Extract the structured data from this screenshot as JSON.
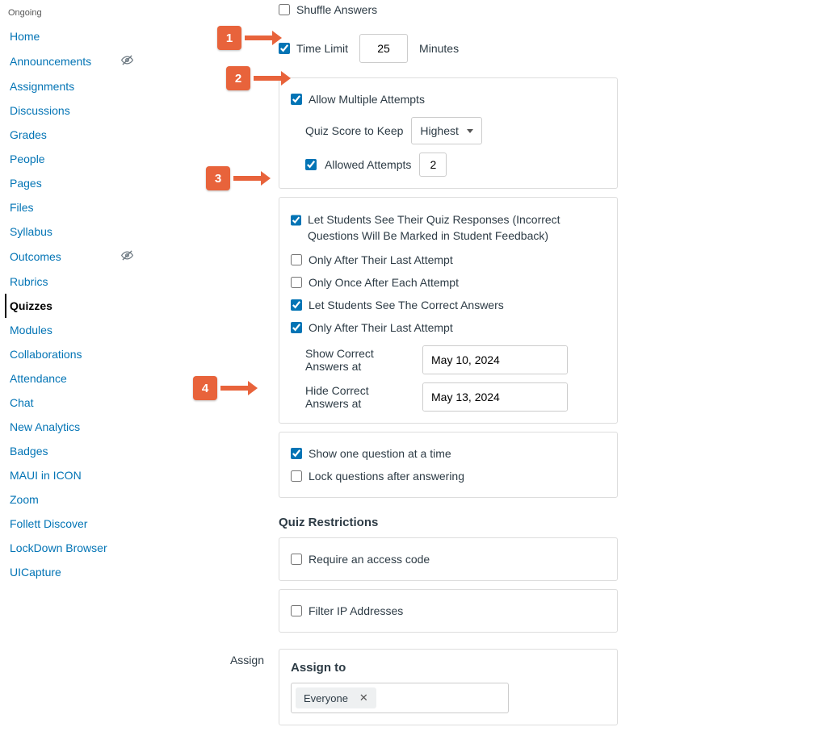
{
  "sidebar": {
    "heading": "Ongoing",
    "items": [
      {
        "label": "Home",
        "hidden": false,
        "active": false
      },
      {
        "label": "Announcements",
        "hidden": true,
        "active": false
      },
      {
        "label": "Assignments",
        "hidden": false,
        "active": false
      },
      {
        "label": "Discussions",
        "hidden": false,
        "active": false
      },
      {
        "label": "Grades",
        "hidden": false,
        "active": false
      },
      {
        "label": "People",
        "hidden": false,
        "active": false
      },
      {
        "label": "Pages",
        "hidden": false,
        "active": false
      },
      {
        "label": "Files",
        "hidden": false,
        "active": false
      },
      {
        "label": "Syllabus",
        "hidden": false,
        "active": false
      },
      {
        "label": "Outcomes",
        "hidden": true,
        "active": false
      },
      {
        "label": "Rubrics",
        "hidden": false,
        "active": false
      },
      {
        "label": "Quizzes",
        "hidden": false,
        "active": true
      },
      {
        "label": "Modules",
        "hidden": false,
        "active": false
      },
      {
        "label": "Collaborations",
        "hidden": false,
        "active": false
      },
      {
        "label": "Attendance",
        "hidden": false,
        "active": false
      },
      {
        "label": "Chat",
        "hidden": false,
        "active": false
      },
      {
        "label": "New Analytics",
        "hidden": false,
        "active": false
      },
      {
        "label": "Badges",
        "hidden": false,
        "active": false
      },
      {
        "label": "MAUI in ICON",
        "hidden": false,
        "active": false
      },
      {
        "label": "Zoom",
        "hidden": false,
        "active": false
      },
      {
        "label": "Follett Discover",
        "hidden": false,
        "active": false
      },
      {
        "label": "LockDown Browser",
        "hidden": false,
        "active": false
      },
      {
        "label": "UICapture",
        "hidden": false,
        "active": false
      }
    ]
  },
  "options": {
    "shuffle": {
      "label": "Shuffle Answers",
      "checked": false
    },
    "time_limit": {
      "label": "Time Limit",
      "checked": true,
      "value": "25",
      "unit": "Minutes"
    },
    "multiple_attempts": {
      "label": "Allow Multiple Attempts",
      "checked": true,
      "score_keep_label": "Quiz Score to Keep",
      "score_keep_value": "Highest",
      "allowed_attempts_label": "Allowed Attempts",
      "allowed_attempts_checked": true,
      "allowed_attempts_value": "2"
    },
    "responses": {
      "label": "Let Students See Their Quiz Responses (Incorrect Questions Will Be Marked in Student Feedback)",
      "checked": true,
      "only_after_last": {
        "label": "Only After Their Last Attempt",
        "checked": false
      },
      "only_once_each": {
        "label": "Only Once After Each Attempt",
        "checked": false
      },
      "see_correct": {
        "label": "Let Students See The Correct Answers",
        "checked": true
      },
      "correct_only_after_last": {
        "label": "Only After Their Last Attempt",
        "checked": true
      },
      "show_at_label": "Show Correct Answers at",
      "show_at_value": "May 10, 2024",
      "hide_at_label": "Hide Correct Answers at",
      "hide_at_value": "May 13, 2024"
    },
    "one_question": {
      "label": "Show one question at a time",
      "checked": true,
      "lock_label": "Lock questions after answering",
      "lock_checked": false
    }
  },
  "restrictions": {
    "heading": "Quiz Restrictions",
    "access_code": {
      "label": "Require an access code",
      "checked": false
    },
    "filter_ip": {
      "label": "Filter IP Addresses",
      "checked": false
    }
  },
  "assign": {
    "row_label": "Assign",
    "title": "Assign to",
    "token": "Everyone"
  },
  "callouts": {
    "1": "1",
    "2": "2",
    "3": "3",
    "4": "4"
  }
}
